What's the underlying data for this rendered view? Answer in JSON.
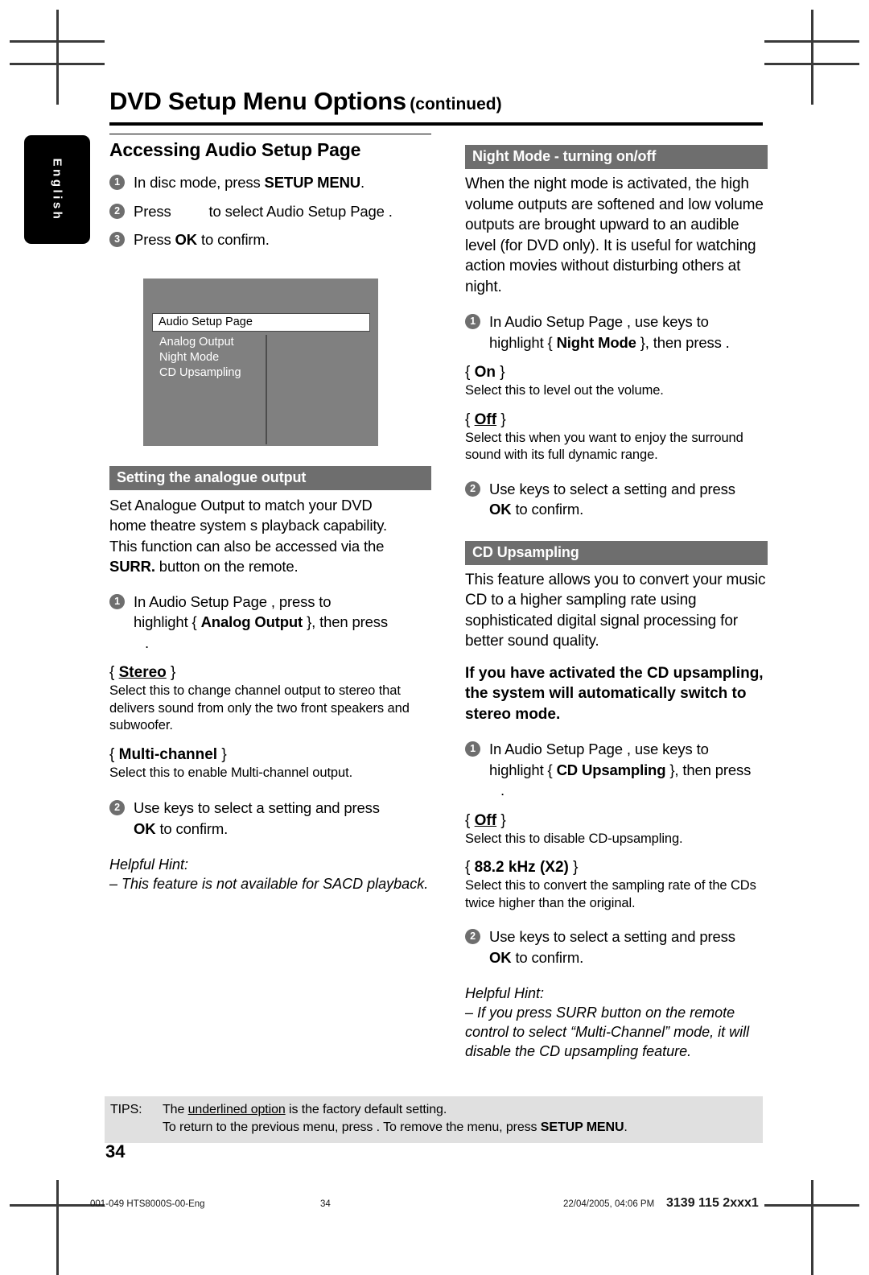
{
  "header": {
    "title_main": "DVD Setup Menu Options",
    "title_suffix": "(continued)"
  },
  "language_tab": {
    "label": "English"
  },
  "left_column": {
    "section_title": "Accessing Audio Setup Page",
    "steps": [
      {
        "num": "1",
        "text_before": "In disc mode, press ",
        "bold": "SETUP MENU",
        "text_after": "."
      },
      {
        "num": "2",
        "text_before": "Press ",
        "bold": "",
        "text_after": "to select  Audio Setup Page ."
      },
      {
        "num": "3",
        "text_before": "Press ",
        "bold": "OK",
        "text_after": " to confirm."
      }
    ],
    "osd": {
      "title": "Audio Setup Page",
      "items": [
        "Analog Output",
        "Night Mode",
        "CD Upsampling"
      ]
    },
    "analogue_section": {
      "heading": "Setting the analogue output",
      "paragraph_1": "Set Analogue Output to match your DVD",
      "paragraph_2": "home theatre system s playback capability.",
      "paragraph_3": "This function can also be accessed via the",
      "paragraph_4_bold": "SURR.",
      "paragraph_4_rest": " button on the remote.",
      "step1_line1": "In  Audio Setup Page , press         to",
      "step1_line2_pre": "highlight { ",
      "step1_line2_bold": "Analog Output",
      "step1_line2_post": " }, then press",
      "step1_line3": ".",
      "options": [
        {
          "name": "Stereo",
          "underlined": true,
          "desc": "Select this to change channel output to stereo that delivers sound from only the two front speakers and subwoofer."
        },
        {
          "name": "Multi-channel",
          "underlined": false,
          "desc": "Select this to enable Multi-channel output."
        }
      ],
      "step2_line1": "Use        keys to select a setting and press",
      "step2_bold": "OK",
      "step2_line2_rest": " to confirm.",
      "hint_title": "Helpful Hint:",
      "hint_body": "–  This feature is not available for SACD playback."
    }
  },
  "right_column": {
    "night_mode": {
      "heading": "Night Mode - turning on/off",
      "paragraph": "When the night mode is activated, the high volume outputs are softened and low volume outputs are brought upward to an audible level (for DVD only).  It is useful for watching action movies without disturbing others at night.",
      "step1_line1": "In  Audio Setup Page , use       keys to",
      "step1_line2_pre": "highlight { ",
      "step1_line2_bold": "Night Mode",
      "step1_line2_post": " }, then press     .",
      "options": [
        {
          "name": "On",
          "underlined": false,
          "desc": "Select this to level out the volume."
        },
        {
          "name": "Off",
          "underlined": true,
          "desc": "Select this when you want to enjoy the surround sound with its full dynamic range."
        }
      ],
      "step2_line1": "Use       keys to select a setting and press",
      "step2_bold": "OK",
      "step2_line2_rest": " to confirm."
    },
    "cd_upsampling": {
      "heading": "CD Upsampling",
      "paragraph": "This feature allows you to convert your music CD to a higher sampling rate using sophisticated digital signal processing for better sound quality.",
      "emphasis": "If you have activated the CD upsampling, the system will automatically switch to stereo mode.",
      "step1_line1": "In  Audio Setup Page , use       keys to",
      "step1_line2_pre": "highlight { ",
      "step1_line2_bold": "CD Upsampling",
      "step1_line2_post": " }, then press",
      "step1_line3": ".",
      "options": [
        {
          "name": "Off",
          "underlined": true,
          "desc": "Select this to disable CD-upsampling."
        },
        {
          "name": "88.2 kHz (X2)",
          "underlined": false,
          "desc": "Select this to convert the sampling rate of the CDs twice higher than the original."
        }
      ],
      "step2_line1": "Use       keys to select a setting and press",
      "step2_bold": "OK",
      "step2_line2_rest": " to confirm.",
      "hint_title": "Helpful Hint:",
      "hint_body": "–  If you press SURR button on the remote control to select “Multi-Channel” mode, it will disable the CD upsampling feature."
    }
  },
  "tips": {
    "label": "TIPS:",
    "line1_pre": "The ",
    "line1_underlined": "underlined option",
    "line1_post": " is the factory default setting.",
    "line2_pre": "To return to the previous menu, press    . To remove the menu, press ",
    "line2_bold": "SETUP MENU",
    "line2_post": "."
  },
  "page_number": "34",
  "footer": {
    "file": "001-049 HTS8000S-00-Eng",
    "page": "34",
    "date": "22/04/2005, 04:06 PM",
    "code": "3139 115 2xxx1"
  }
}
